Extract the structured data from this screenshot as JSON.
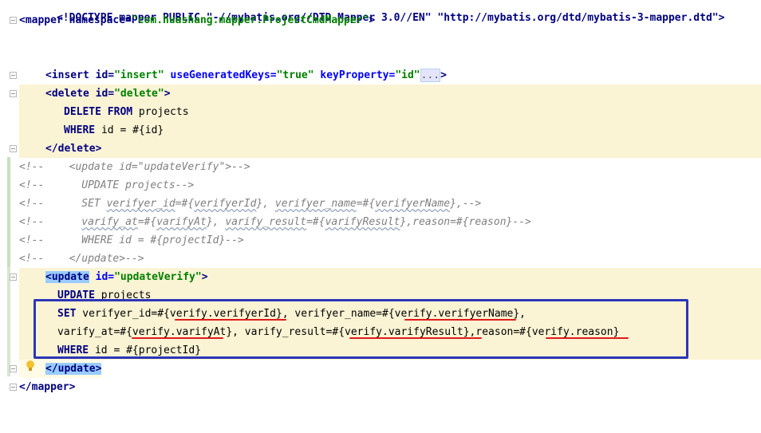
{
  "editor": {
    "lines": [
      {
        "id": "doctype",
        "text": "<!DOCTYPE mapper PUBLIC \"-//mybatis.org//DTD Mapper 3.0//EN\" \"http://mybatis.org/dtd/mybatis-3-mapper.dtd\">"
      },
      {
        "id": "mapper_open_1",
        "text": "<mapper namespace="
      },
      {
        "id": "mapper_open_ns",
        "text": "\"com.huashang.mapper.ProjectCmdMapper\""
      },
      {
        "id": "mapper_open_end",
        "text": ">"
      },
      {
        "id": "insert_1",
        "text": "<insert id="
      },
      {
        "id": "insert_2",
        "text": "\"insert\""
      },
      {
        "id": "insert_3",
        "text": " useGeneratedKeys="
      },
      {
        "id": "insert_4",
        "text": "\"true\""
      },
      {
        "id": "insert_5",
        "text": " keyProperty="
      },
      {
        "id": "insert_6",
        "text": "\"id\""
      },
      {
        "id": "insert_7",
        "text": "..."
      },
      {
        "id": "insert_8",
        "text": ">"
      },
      {
        "id": "delete_1",
        "text": "<delete id="
      },
      {
        "id": "delete_2",
        "text": "\"delete\""
      },
      {
        "id": "delete_3",
        "text": ">"
      },
      {
        "id": "del_sql1a",
        "text": "DELETE FROM"
      },
      {
        "id": "del_sql1b",
        "text": " projects"
      },
      {
        "id": "del_sql2a",
        "text": "WHERE"
      },
      {
        "id": "del_sql2b",
        "text": " id = #{id}"
      },
      {
        "id": "delete_close",
        "text": "</delete>"
      },
      {
        "id": "c1",
        "text": "<!--    <update id=\"updateVerify\">-->"
      },
      {
        "id": "c2",
        "text": "<!--      UPDATE projects-->"
      },
      {
        "id": "c3a",
        "text": "<!--      SET "
      },
      {
        "id": "c3b",
        "text": "verifyer_id"
      },
      {
        "id": "c3c",
        "text": "=#{"
      },
      {
        "id": "c3d",
        "text": "verifyerId"
      },
      {
        "id": "c3e",
        "text": "}, "
      },
      {
        "id": "c3f",
        "text": "verifyer_name"
      },
      {
        "id": "c3g",
        "text": "=#{"
      },
      {
        "id": "c3h",
        "text": "verifyerName"
      },
      {
        "id": "c3i",
        "text": "},-->"
      },
      {
        "id": "c4a",
        "text": "<!--      "
      },
      {
        "id": "c4b",
        "text": "varify_at"
      },
      {
        "id": "c4c",
        "text": "=#{"
      },
      {
        "id": "c4d",
        "text": "varifyAt"
      },
      {
        "id": "c4e",
        "text": "}, "
      },
      {
        "id": "c4f",
        "text": "varify_result"
      },
      {
        "id": "c4g",
        "text": "=#{"
      },
      {
        "id": "c4h",
        "text": "varifyResult"
      },
      {
        "id": "c4i",
        "text": "},reason=#{reason}-->"
      },
      {
        "id": "c5",
        "text": "<!--      WHERE id = #{projectId}-->"
      },
      {
        "id": "c6",
        "text": "<!--    </update>-->"
      },
      {
        "id": "update_1",
        "text": "<update"
      },
      {
        "id": "update_2",
        "text": " id="
      },
      {
        "id": "update_3",
        "text": "\"updateVerify\""
      },
      {
        "id": "update_4",
        "text": ">"
      },
      {
        "id": "u_sql1a",
        "text": "UPDATE"
      },
      {
        "id": "u_sql1b",
        "text": " projects"
      },
      {
        "id": "u_sql2a",
        "text": "SET"
      },
      {
        "id": "u_sql2b",
        "text": " verifyer_id=#{verify.verifyerId}, verifyer_name=#{verify.verifyerName},"
      },
      {
        "id": "u_sql3",
        "text": "varify_at=#{verify.varifyAt}, varify_result=#{verify.varifyResult},reason=#{verify.reason}"
      },
      {
        "id": "u_sql4a",
        "text": "WHERE"
      },
      {
        "id": "u_sql4b",
        "text": " id = #{projectId}"
      },
      {
        "id": "update_close",
        "text": "</update>"
      },
      {
        "id": "mapper_close",
        "text": "</mapper>"
      }
    ]
  },
  "colors": {
    "highlight_bg": "#faf3d4",
    "annotation_box": "#2c35b8",
    "annotation_underline": "#e01c1c",
    "tag": "#000080",
    "attribute": "#0000ff",
    "string": "#008000",
    "comment": "#808080"
  },
  "icons": {
    "bulb": "lightbulb-icon",
    "fold": "fold-marker-icon"
  }
}
